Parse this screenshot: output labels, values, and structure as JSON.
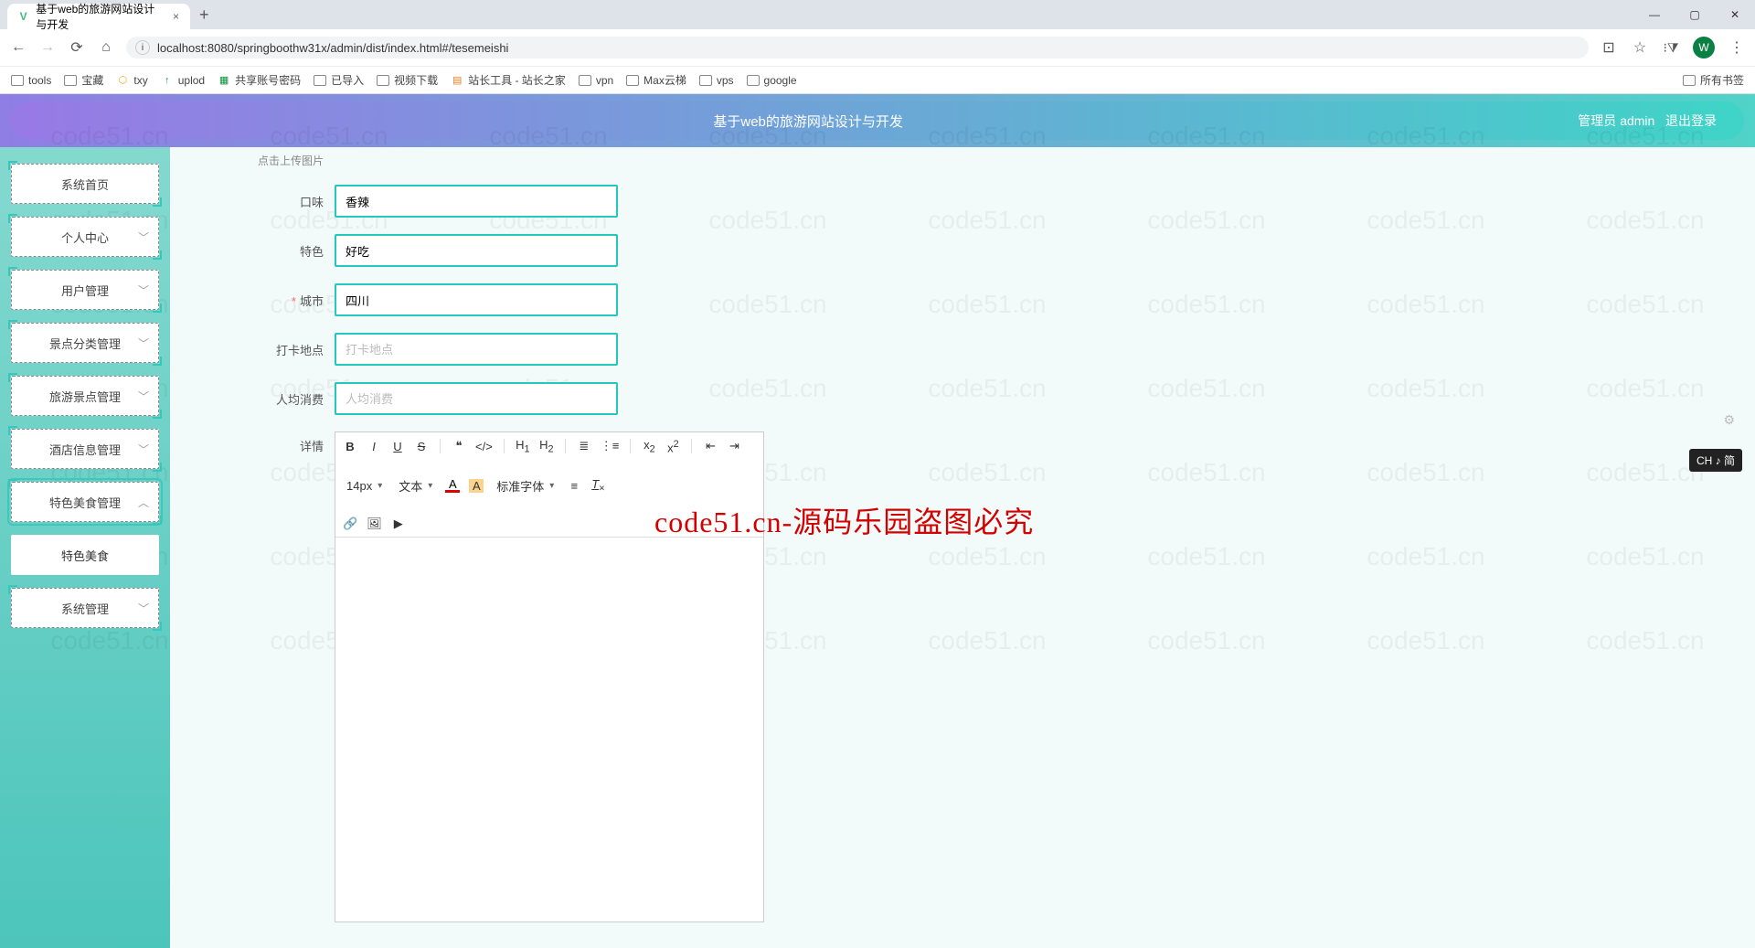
{
  "browser": {
    "tab_title": "基于web的旅游网站设计与开发",
    "url": "localhost:8080/springboothw31x/admin/dist/index.html#/tesemeishi",
    "new_tab": "+",
    "profile_letter": "W",
    "bookmarks": [
      {
        "label": "tools",
        "kind": "folder"
      },
      {
        "label": "宝藏",
        "kind": "folder"
      },
      {
        "label": "txy",
        "kind": "icon",
        "glyph": "⬡"
      },
      {
        "label": "uplod",
        "kind": "icon",
        "glyph": "↑"
      },
      {
        "label": "共享账号密码",
        "kind": "icon",
        "glyph": "▦",
        "color": "#0a8f3c"
      },
      {
        "label": "已导入",
        "kind": "folder"
      },
      {
        "label": "视频下载",
        "kind": "folder"
      },
      {
        "label": "站长工具 - 站长之家",
        "kind": "icon",
        "glyph": "▤",
        "color": "#e67e22"
      },
      {
        "label": "vpn",
        "kind": "folder"
      },
      {
        "label": "Max云梯",
        "kind": "folder"
      },
      {
        "label": "vps",
        "kind": "folder"
      },
      {
        "label": "google",
        "kind": "folder"
      }
    ],
    "all_bookmarks": "所有书签"
  },
  "header": {
    "title": "基于web的旅游网站设计与开发",
    "user_role": "管理员",
    "user_name": "admin",
    "logout": "退出登录"
  },
  "sidebar": {
    "items": [
      {
        "label": "系统首页",
        "expandable": false
      },
      {
        "label": "个人中心",
        "expandable": true
      },
      {
        "label": "用户管理",
        "expandable": true
      },
      {
        "label": "景点分类管理",
        "expandable": true
      },
      {
        "label": "旅游景点管理",
        "expandable": true
      },
      {
        "label": "酒店信息管理",
        "expandable": true
      },
      {
        "label": "特色美食管理",
        "expandable": true,
        "expanded": true
      },
      {
        "label": "特色美食",
        "sub": true
      },
      {
        "label": "系统管理",
        "expandable": true
      }
    ]
  },
  "form": {
    "upload_hint": "点击上传图片",
    "fields": {
      "taste": {
        "label": "口味",
        "value": "香辣"
      },
      "feature": {
        "label": "特色",
        "value": "好吃"
      },
      "city": {
        "label": "城市",
        "value": "四川",
        "required": true
      },
      "checkin": {
        "label": "打卡地点",
        "placeholder": "打卡地点",
        "value": ""
      },
      "avgcost": {
        "label": "人均消费",
        "placeholder": "人均消费",
        "value": ""
      }
    },
    "detail_label": "详情"
  },
  "editor": {
    "font_size": "14px",
    "type_label": "文本",
    "font_family": "标准字体"
  },
  "watermark": "code51.cn",
  "overlay": "code51.cn-源码乐园盗图必究",
  "ime": "CH ♪ 简"
}
